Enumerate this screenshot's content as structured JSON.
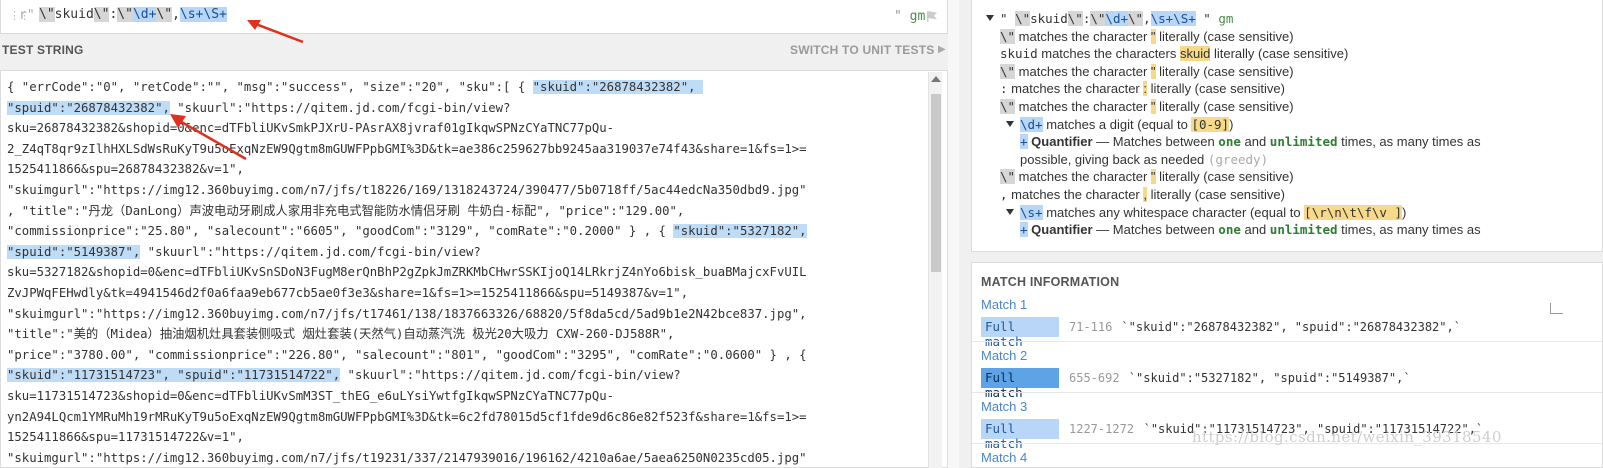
{
  "regex": {
    "delimiter": "r\"",
    "flags_quote": "\"",
    "flags": "gm",
    "expr": [
      {
        "t": "\\\"",
        "c": "gtok"
      },
      {
        "t": "skuid",
        "c": ""
      },
      {
        "t": "\\\"",
        "c": "gtok"
      },
      {
        "t": ":",
        "c": ""
      },
      {
        "t": "\\\"",
        "c": "gtok"
      },
      {
        "t": "\\d+",
        "c": "btok"
      },
      {
        "t": "\\\"",
        "c": "gtok"
      },
      {
        "t": ",",
        "c": ""
      },
      {
        "t": "\\s+\\S+",
        "c": "btok"
      }
    ]
  },
  "test_string": {
    "title": "TEST STRING",
    "switch_label": "SWITCH TO UNIT TESTS",
    "lines": [
      [
        {
          "t": "{ \"errCode\":\"0\", \"retCode\":\"\", \"msg\":\"success\", \"size\":\"20\", \"sku\":[ { "
        },
        {
          "t": "\"skuid\":\"26878432382\", ",
          "h": 1
        }
      ],
      [
        {
          "t": "\"spuid\":\"26878432382\",",
          "h": 1
        },
        {
          "t": " \"skuurl\":\"https://qitem.jd.com/fcgi-bin/view?"
        }
      ],
      [
        {
          "t": "sku=26878432382&shopid=0&enc=dTFbliUKvSmkPJXrU-PAsrAX8jvraf01gIkqwSPNzCYaTNC77pQu-"
        }
      ],
      [
        {
          "t": "2_Z4qT8qr9zIlhHXLSdWsRuKyT9u5oExqNzEW9Qgtm8mGUWFPpbGMI%3D&tk=ae386c259627bb9245aa319037e74f43&share=1&fs=1>="
        }
      ],
      [
        {
          "t": "1525411866&spu=26878432382&v=1\","
        }
      ],
      [
        {
          "t": "\"skuimgurl\":\"https://img12.360buyimg.com/n7/jfs/t18226/169/1318243724/390477/5b0718ff/5ac44edcNa350dbd9.jpg\""
        }
      ],
      [
        {
          "t": ", \"title\":\"丹龙（DanLong）声波电动牙刷成人家用非充电式智能防水情侣牙刷 牛奶白-标配\", \"price\":\"129.00\","
        }
      ],
      [
        {
          "t": "\"commissionprice\":\"25.80\", \"salecount\":\"6605\", \"goodCom\":\"3129\", \"comRate\":\"0.2000\" } , { "
        },
        {
          "t": "\"skuid\":\"5327182\",",
          "h": 1
        }
      ],
      [
        {
          "t": "\"spuid\":\"5149387\",",
          "h": 1
        },
        {
          "t": " \"skuurl\":\"https://qitem.jd.com/fcgi-bin/view?"
        }
      ],
      [
        {
          "t": "sku=5327182&shopid=0&enc=dTFbliUKvSnSDoN3FugM8erQnBhP2gZpkJmZRKMbCHwrSSKIjoQ14LRkrjZ4nYo6bisk_buaBMajcxFvUIL"
        }
      ],
      [
        {
          "t": "ZvJPWqFEHwdly&tk=4941546d2f0a6faa9eb677cb5ae0f3e3&share=1&fs=1>=1525411866&spu=5149387&v=1\","
        }
      ],
      [
        {
          "t": "\"skuimgurl\":\"https://img12.360buyimg.com/n7/jfs/t17461/138/1837663326/68820/5f8da5cd/5ad9b1e2N42bce837.jpg\","
        }
      ],
      [
        {
          "t": "\"title\":\"美的（Midea）抽油烟机灶具套装侧吸式 烟灶套装(天然气)自动蒸汽洗 极光20大吸力 CXW-260-DJ588R\","
        }
      ],
      [
        {
          "t": "\"price\":\"3780.00\", \"commissionprice\":\"226.80\", \"salecount\":\"801\", \"goodCom\":\"3295\", \"comRate\":\"0.0600\" } , {"
        }
      ],
      [
        {
          "t": "\"skuid\":\"11731514723\", \"spuid\":\"11731514722\",",
          "h": 1
        },
        {
          "t": " \"skuurl\":\"https://qitem.jd.com/fcgi-bin/view?"
        }
      ],
      [
        {
          "t": "sku=11731514723&shopid=0&enc=dTFbliUKvSmM3ST_thEG_e6uLYsiYwtfgIkqwSPNzCYaTNC77pQu-"
        }
      ],
      [
        {
          "t": "yn2A94LQcm1YMRuMh19rMRuKyT9u5oExqNzEW9Qgtm8mGUWFPpbGMI%3D&tk=6c2fd78015d5cf1fde9d6c86e82f523f&share=1&fs=1>="
        }
      ],
      [
        {
          "t": "1525411866&spu=11731514722&v=1\","
        }
      ],
      [
        {
          "t": "\"skuimgurl\":\"https://img12.360buyimg.com/n7/jfs/t19231/337/2147939016/196162/4210a6ae/5aea6250N0235cd05.jpg\""
        }
      ]
    ]
  },
  "explanation": {
    "lines": [
      {
        "indent": 0,
        "tri": true,
        "parts": [
          {
            "t": "\" ",
            "c": "mono"
          },
          {
            "t": "\\\"",
            "c": "mono gb"
          },
          {
            "t": "skuid",
            "c": "mono"
          },
          {
            "t": "\\\"",
            "c": "mono gb"
          },
          {
            "t": ":",
            "c": "mono"
          },
          {
            "t": "\\\"",
            "c": "mono gb"
          },
          {
            "t": "\\d+",
            "c": "mono bt"
          },
          {
            "t": "\\\"",
            "c": "mono gb"
          },
          {
            "t": ",",
            "c": "mono"
          },
          {
            "t": "\\s+\\S+",
            "c": "mono bt"
          },
          {
            "t": " \" ",
            "c": "mono"
          },
          {
            "t": "gm",
            "c": "mono green-f"
          }
        ]
      },
      {
        "indent": 1,
        "parts": [
          {
            "t": "\\\"",
            "c": "mono gb"
          },
          {
            "t": " matches the character "
          },
          {
            "t": "\"",
            "c": "y"
          },
          {
            "t": " literally (case sensitive)"
          }
        ]
      },
      {
        "indent": 1,
        "parts": [
          {
            "t": "skuid",
            "c": "mono"
          },
          {
            "t": " matches the characters "
          },
          {
            "t": "skuid",
            "c": "y"
          },
          {
            "t": " literally (case sensitive)"
          }
        ]
      },
      {
        "indent": 1,
        "parts": [
          {
            "t": "\\\"",
            "c": "mono gb"
          },
          {
            "t": " matches the character "
          },
          {
            "t": "\"",
            "c": "y"
          },
          {
            "t": " literally (case sensitive)"
          }
        ]
      },
      {
        "indent": 1,
        "parts": [
          {
            "t": ":",
            "c": "mono"
          },
          {
            "t": " matches the character "
          },
          {
            "t": ":",
            "c": "y"
          },
          {
            "t": " literally (case sensitive)"
          }
        ]
      },
      {
        "indent": 1,
        "parts": [
          {
            "t": "\\\"",
            "c": "mono gb"
          },
          {
            "t": " matches the character "
          },
          {
            "t": "\"",
            "c": "y"
          },
          {
            "t": " literally (case sensitive)"
          }
        ]
      },
      {
        "indent": 2,
        "tri": true,
        "parts": [
          {
            "t": "\\d+",
            "c": "mono bt"
          },
          {
            "t": " matches a digit (equal to "
          },
          {
            "t": "[0-9]",
            "c": "mono y"
          },
          {
            "t": ")"
          }
        ]
      },
      {
        "indent": 3,
        "parts": [
          {
            "t": "+",
            "c": "mono bt"
          },
          {
            "t": " "
          },
          {
            "t": "Quantifier",
            "c": "b"
          },
          {
            "t": " — Matches between "
          },
          {
            "t": "one",
            "c": "green"
          },
          {
            "t": " and "
          },
          {
            "t": "unlimited",
            "c": "green"
          },
          {
            "t": " times, as many times as"
          }
        ]
      },
      {
        "indent": 3,
        "parts": [
          {
            "t": "possible, giving back as needed "
          },
          {
            "t": "(greedy)",
            "c": "grey"
          }
        ]
      },
      {
        "indent": 1,
        "parts": [
          {
            "t": "\\\"",
            "c": "mono gb"
          },
          {
            "t": " matches the character "
          },
          {
            "t": "\"",
            "c": "y"
          },
          {
            "t": " literally (case sensitive)"
          }
        ]
      },
      {
        "indent": 1,
        "parts": [
          {
            "t": ",",
            "c": "mono"
          },
          {
            "t": " matches the character "
          },
          {
            "t": ",",
            "c": "y"
          },
          {
            "t": " literally (case sensitive)"
          }
        ]
      },
      {
        "indent": 2,
        "tri": true,
        "parts": [
          {
            "t": "\\s+",
            "c": "mono bt"
          },
          {
            "t": " matches any whitespace character (equal to "
          },
          {
            "t": "[\\r\\n\\t\\f\\v ]",
            "c": "mono y"
          },
          {
            "t": ")"
          }
        ]
      },
      {
        "indent": 3,
        "parts": [
          {
            "t": "+",
            "c": "mono bt"
          },
          {
            "t": " "
          },
          {
            "t": "Quantifier",
            "c": "b"
          },
          {
            "t": " — Matches between "
          },
          {
            "t": "one",
            "c": "green"
          },
          {
            "t": " and "
          },
          {
            "t": "unlimited",
            "c": "green"
          },
          {
            "t": " times, as many times as"
          }
        ]
      }
    ]
  },
  "match_info": {
    "title": "MATCH INFORMATION",
    "matches": [
      {
        "label": "Match 1",
        "badge": "Full match",
        "range": "71-116",
        "text": "`\"skuid\":\"26878432382\", \"spuid\":\"26878432382\",`"
      },
      {
        "label": "Match 2",
        "badge": "Full match",
        "range": "655-692",
        "text": "`\"skuid\":\"5327182\", \"spuid\":\"5149387\",`"
      },
      {
        "label": "Match 3",
        "badge": "Full match",
        "range": "1227-1272",
        "text": "`\"skuid\":\"11731514723\", \"spuid\":\"11731514722\",`"
      },
      {
        "label": "Match 4"
      }
    ]
  },
  "watermark": "https://blog.csdn.net/weixin_39318540"
}
